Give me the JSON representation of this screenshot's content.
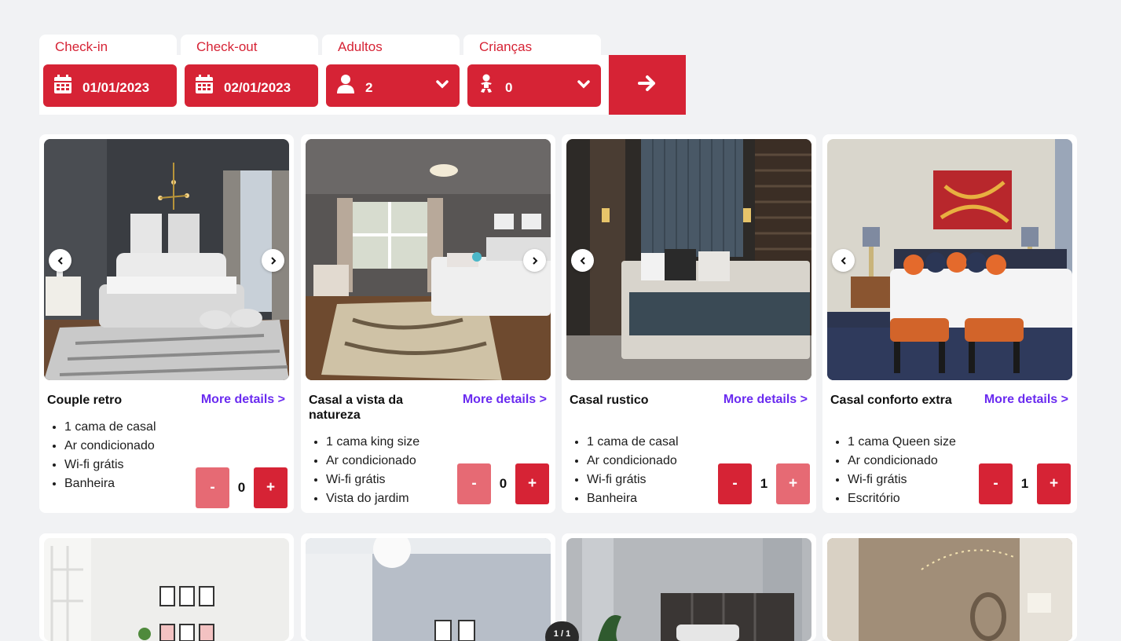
{
  "search": {
    "checkin": {
      "label": "Check-in",
      "value": "01/01/2023",
      "icon": "calendar-icon"
    },
    "checkout": {
      "label": "Check-out",
      "value": "02/01/2023",
      "icon": "calendar-icon"
    },
    "adults": {
      "label": "Adultos",
      "value": "2",
      "icon": "person-icon"
    },
    "children": {
      "label": "Crianças",
      "value": "0",
      "icon": "baby-icon"
    },
    "submit_icon": "arrow-right-icon",
    "accent_color": "#d62335"
  },
  "rooms": [
    {
      "title": "Couple retro",
      "link": "More details >",
      "features": [
        "1 cama de casal",
        "Ar condicionado",
        "Wi-fi grátis",
        "Banheira"
      ],
      "quantity": "0",
      "minus": "-",
      "plus": "+"
    },
    {
      "title": "Casal a vista da natureza",
      "link": "More details >",
      "features": [
        "1 cama king size",
        "Ar condicionado",
        "Wi-fi grátis",
        "Vista do jardim"
      ],
      "quantity": "0",
      "minus": "-",
      "plus": "+"
    },
    {
      "title": "Casal rustico",
      "link": "More details >",
      "features": [
        "1 cama de casal",
        "Ar condicionado",
        "Wi-fi grátis",
        "Banheira"
      ],
      "quantity": "1",
      "minus": "-",
      "plus": "+"
    },
    {
      "title": "Casal conforto extra",
      "link": "More details >",
      "features": [
        "1 cama Queen size",
        "Ar condicionado",
        "Wi-fi grátis",
        "Escritório"
      ],
      "quantity": "1",
      "minus": "-",
      "plus": "+"
    }
  ],
  "pager": {
    "text": "1 / 1"
  },
  "link_color": "#6a2bf0"
}
